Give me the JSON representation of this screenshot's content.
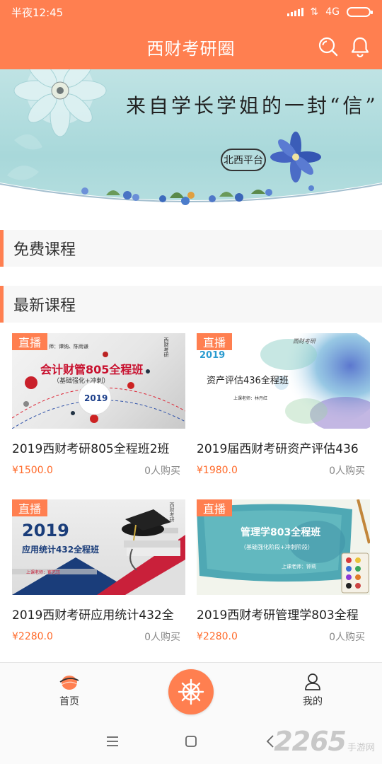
{
  "status_bar": {
    "time": "半夜12:45",
    "network": "4G"
  },
  "header": {
    "title": "西财考研圈"
  },
  "banner": {
    "headline": "来自学长学姐的一封“信”",
    "seal_text": "北西平台"
  },
  "sections": {
    "free_courses": "免费课程",
    "latest_courses": "最新课程"
  },
  "courses": [
    {
      "badge": "直播",
      "title": "2019西财考研805全程班2班",
      "price": "¥1500.0",
      "buyers": "0人购买",
      "thumb_title": "会计财管805全程班",
      "thumb_sub": "（基础强化+冲刺）",
      "thumb_year": "2019",
      "thumb_teachers": "师：谭纳、陈雨谦",
      "thumb_logo": "西财考研"
    },
    {
      "badge": "直播",
      "title": "2019届西财考研资产评估436",
      "price": "¥1980.0",
      "buyers": "0人购买",
      "thumb_title": "资产评估436全程班",
      "thumb_year": "2019",
      "thumb_teacher": "上课老师：林丹红",
      "thumb_logo": "西财考研"
    },
    {
      "badge": "直播",
      "title": "2019西财考研应用统计432全",
      "price": "¥2280.0",
      "buyers": "0人购买",
      "thumb_year": "2019",
      "thumb_title": "应用统计432全程班",
      "thumb_teacher": "上课老师：崔艺珏",
      "thumb_logo": "西财考研"
    },
    {
      "badge": "直播",
      "title": "2019西财考研管理学803全程",
      "price": "¥2280.0",
      "buyers": "0人购买",
      "thumb_title": "管理学803全程班",
      "thumb_sub": "（基础强化阶段+冲刺阶段）",
      "thumb_teacher": "上课老师：钟莉"
    }
  ],
  "bottom_nav": {
    "home": "首页",
    "mine": "我的"
  },
  "watermark": {
    "number": "2265",
    "text": "手游网"
  },
  "colors": {
    "accent": "#ff7f50",
    "price": "#ff6a2a"
  },
  "icons": [
    "search-icon",
    "bell-icon",
    "home-icon",
    "helm-icon",
    "person-icon",
    "menu-icon",
    "square-icon",
    "back-icon"
  ]
}
